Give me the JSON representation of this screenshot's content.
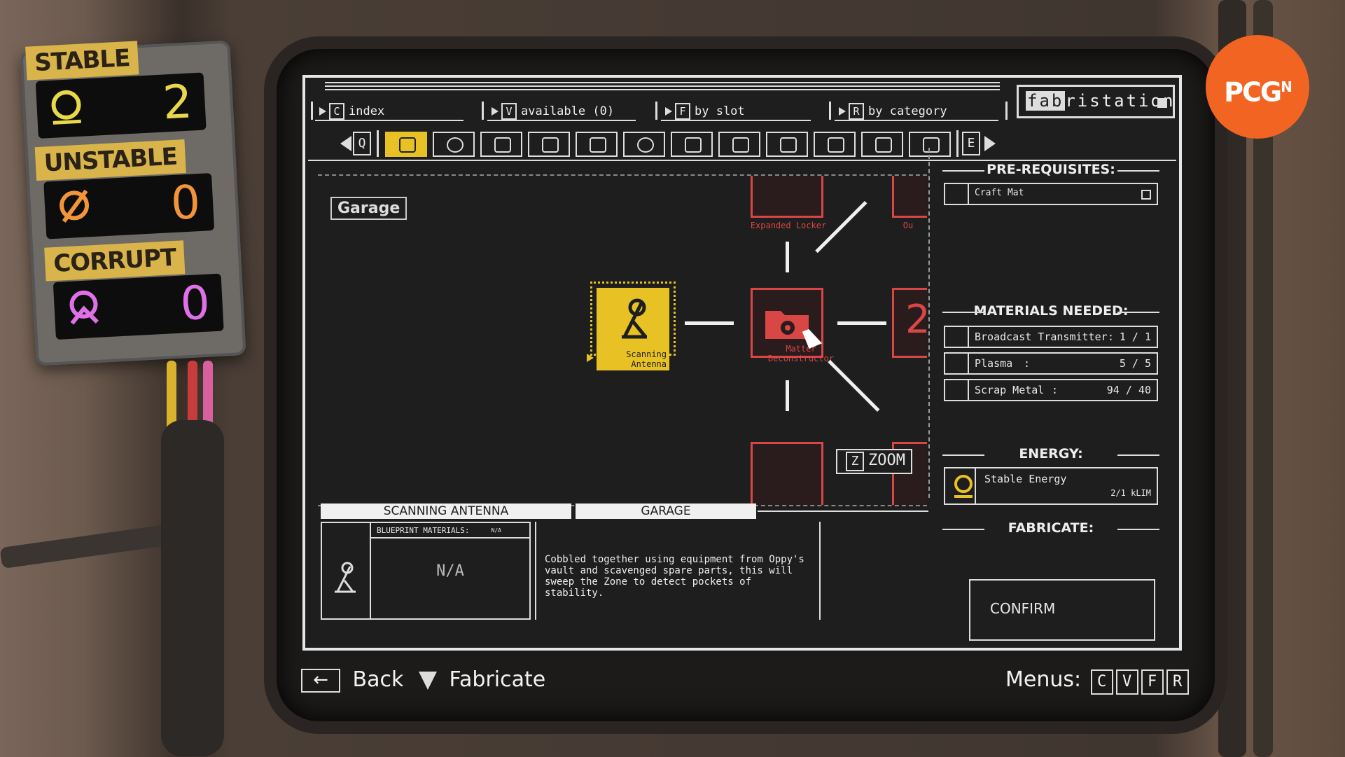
{
  "side_panel": {
    "stable": {
      "label": "STABLE",
      "value": "2",
      "color": "#e8d84a"
    },
    "unstable": {
      "label": "UNSTABLE",
      "value": "0",
      "color": "#f2943a"
    },
    "corrupt": {
      "label": "CORRUPT",
      "value": "0",
      "color": "#e070e8"
    }
  },
  "topbar": {
    "menus": [
      {
        "key": "C",
        "label": "index"
      },
      {
        "key": "V",
        "label": "available (0)"
      },
      {
        "key": "F",
        "label": "by slot"
      },
      {
        "key": "R",
        "label": "by category"
      }
    ],
    "brand_prefix": "fab",
    "brand_suffix": "ristation"
  },
  "category_strip": {
    "prev_key": "Q",
    "next_key": "E",
    "icons": [
      "monitor-icon",
      "gear-icon",
      "medkit-icon",
      "radio-icon",
      "battery-icon",
      "target-icon",
      "car-icon",
      "car-side-icon",
      "boot-icon",
      "engine-icon",
      "gauge-icon",
      "motor-icon"
    ],
    "active_index": 0
  },
  "graph": {
    "section_label": "Garage",
    "nodes": [
      {
        "label": "Expanded Locker"
      },
      {
        "label": "Ou"
      },
      {
        "label": "Scanning Antenna"
      },
      {
        "label": "Matter Deconstructor"
      },
      {
        "label": "2"
      }
    ],
    "zoom_key": "Z",
    "zoom_label": "ZOOM"
  },
  "prerequisites": {
    "title": "PRE-REQUISITES:",
    "items": [
      {
        "name": "Craft Mat"
      }
    ]
  },
  "materials": {
    "title": "MATERIALS NEEDED:",
    "items": [
      {
        "name": "Broadcast Transmitter",
        "sep": ":",
        "qty": "1 / 1"
      },
      {
        "name": "Plasma",
        "sep": ":",
        "qty": "5 / 5"
      },
      {
        "name": "Scrap Metal",
        "sep": ":",
        "qty": "94 / 40"
      }
    ]
  },
  "energy": {
    "title": "ENERGY:",
    "name": "Stable Energy",
    "value": "2/1 kLIM",
    "color": "#e8c225"
  },
  "fabricate": {
    "title": "FABRICATE:",
    "confirm": "CONFIRM"
  },
  "details": {
    "tab_item": "SCANNING ANTENNA",
    "tab_category": "GARAGE",
    "bp_title": "BLUEPRINT MATERIALS:",
    "bp_na_small": "N/A",
    "bp_na": "N/A",
    "description": "Cobbled together using equipment from Oppy's vault and scavenged spare parts, this will sweep the Zone to detect pockets of stability."
  },
  "footer": {
    "back": "Back",
    "fabricate": "Fabricate",
    "menus_label": "Menus:",
    "menu_keys": [
      "C",
      "V",
      "F",
      "R"
    ]
  },
  "watermark": {
    "text": "PCG",
    "sup": "N",
    "color": "#f26422"
  },
  "colors": {
    "accent_yellow": "#e8c225",
    "node_red": "#d84646",
    "screen_bg": "#1e1e1e"
  }
}
